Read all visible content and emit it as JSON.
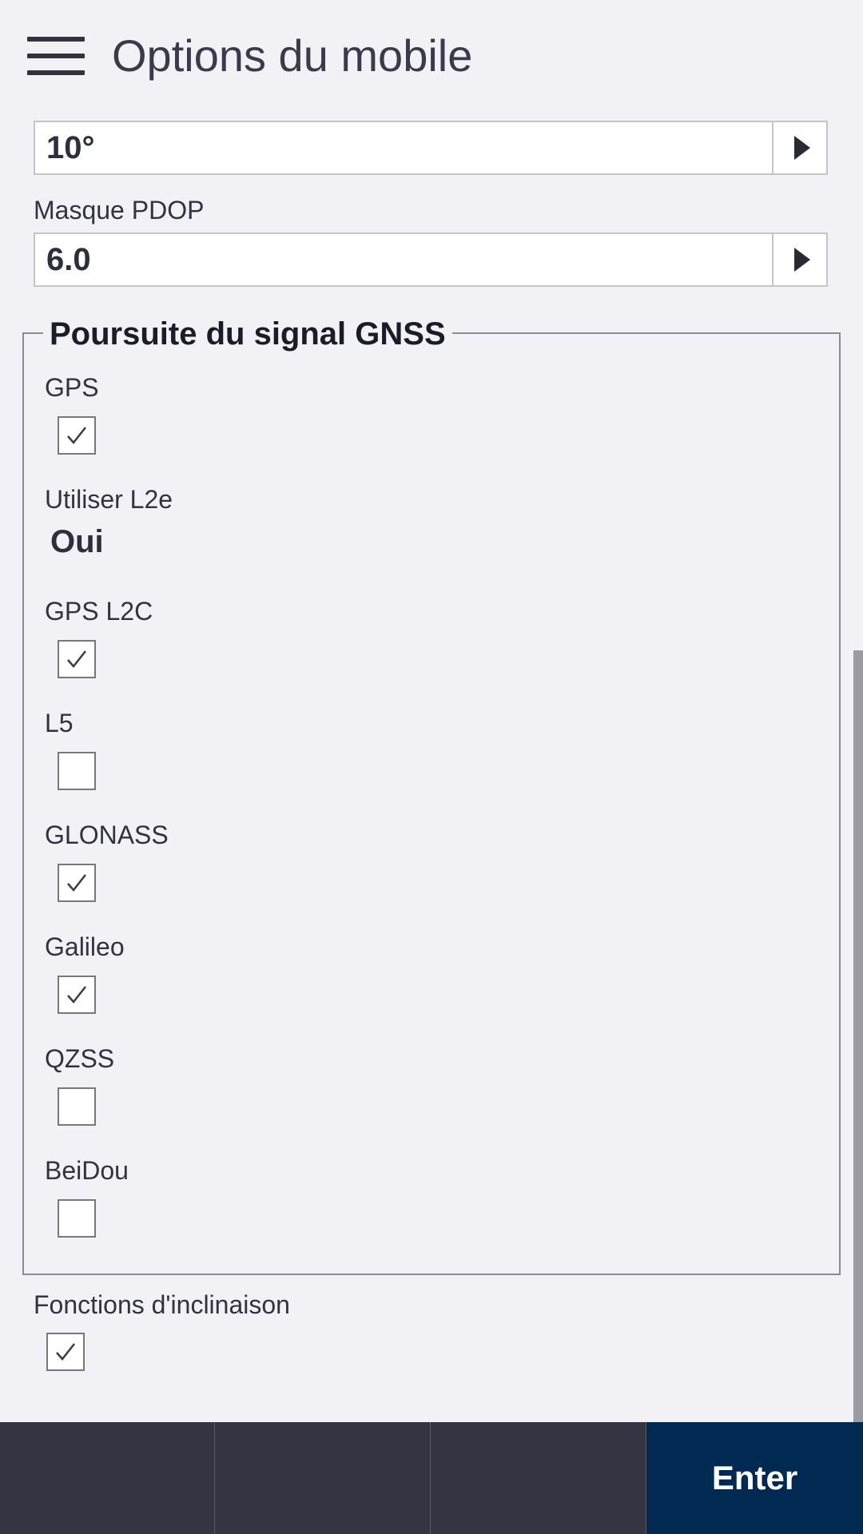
{
  "header": {
    "title": "Options du mobile",
    "menu_icon": "hamburger-menu-icon"
  },
  "fields": {
    "elevation_mask_value": "10°",
    "pdop_label": "Masque PDOP",
    "pdop_value": "6.0"
  },
  "gnss_group": {
    "title": "Poursuite du signal GNSS",
    "items": [
      {
        "label": "GPS",
        "type": "checkbox",
        "checked": true
      },
      {
        "label": "Utiliser L2e",
        "type": "value",
        "value": "Oui"
      },
      {
        "label": "GPS L2C",
        "type": "checkbox",
        "checked": true
      },
      {
        "label": "L5",
        "type": "checkbox",
        "checked": false
      },
      {
        "label": "GLONASS",
        "type": "checkbox",
        "checked": true
      },
      {
        "label": "Galileo",
        "type": "checkbox",
        "checked": true
      },
      {
        "label": "QZSS",
        "type": "checkbox",
        "checked": false
      },
      {
        "label": "BeiDou",
        "type": "checkbox",
        "checked": false
      }
    ]
  },
  "tilt": {
    "label": "Fonctions d'inclinaison",
    "checked": true
  },
  "softkeys": {
    "enter_label": "Enter"
  },
  "colors": {
    "background": "#f1f1f6",
    "bottom_bar": "#343443",
    "enter_button": "#002a52"
  }
}
